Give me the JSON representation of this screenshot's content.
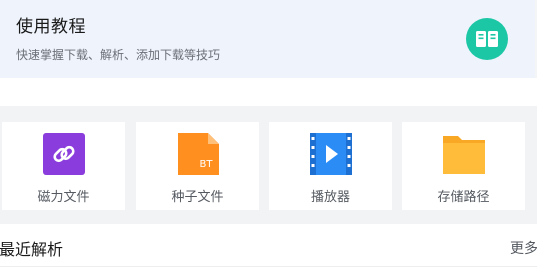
{
  "tutorial": {
    "title": "使用教程",
    "subtitle": "快速掌握下载、解析、添加下载等技巧",
    "icon": "book-icon",
    "icon_color": "#1cc7a6"
  },
  "tools": [
    {
      "label": "磁力文件",
      "icon": "magnet-link-icon",
      "color": "#8a3cdc"
    },
    {
      "label": "种子文件",
      "icon": "bt-torrent-file-icon",
      "color": "#ff8f1f",
      "badge": "BT"
    },
    {
      "label": "播放器",
      "icon": "video-player-icon",
      "color": "#2b8cf5"
    },
    {
      "label": "存储路径",
      "icon": "folder-icon",
      "color": "#ffbb3a"
    }
  ],
  "recent": {
    "title": "最近解析",
    "more_label": "更多"
  }
}
